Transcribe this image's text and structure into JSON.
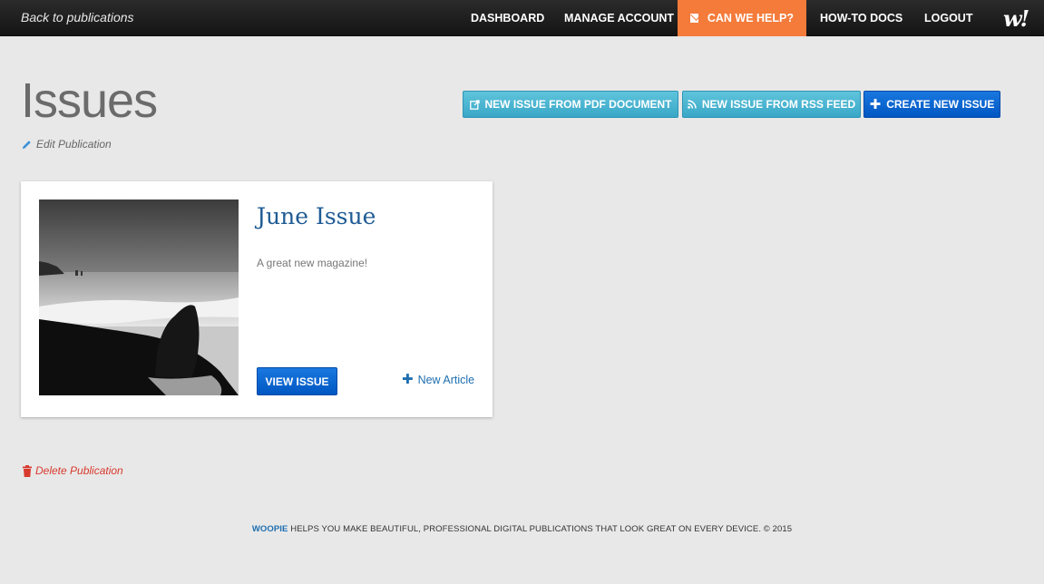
{
  "topbar": {
    "back_label": "Back to publications",
    "nav": {
      "dashboard": "DASHBOARD",
      "manage_account": "MANAGE ACCOUNT",
      "help": "CAN WE HELP?",
      "howto": "HOW-TO DOCS",
      "logout": "LOGOUT"
    },
    "logo_text": "w!",
    "help_color": "#f47b3a"
  },
  "page": {
    "title": "Issues",
    "edit_label": "Edit Publication"
  },
  "actions": {
    "pdf_label": "NEW ISSUE FROM PDF DOCUMENT",
    "rss_label": "NEW ISSUE FROM RSS FEED",
    "create_label": "CREATE NEW ISSUE",
    "pdf_icon": "external-document-icon",
    "rss_icon": "rss-icon",
    "create_icon": "plus-icon"
  },
  "issues": [
    {
      "title": "June Issue",
      "description": "A great new magazine!",
      "view_label": "VIEW ISSUE",
      "new_article_label": "New Article"
    }
  ],
  "delete_label": "Delete Publication",
  "footer": {
    "brand": "WOOPIE",
    "text": " HELPS YOU MAKE BEAUTIFUL, PROFESSIONAL DIGITAL PUBLICATIONS THAT LOOK GREAT ON EVERY DEVICE. © 2015"
  },
  "colors": {
    "accent_blue": "#0057c2",
    "teal": "#3aa7c7",
    "title_blue": "#1f5b94",
    "danger": "#d83a2e"
  }
}
